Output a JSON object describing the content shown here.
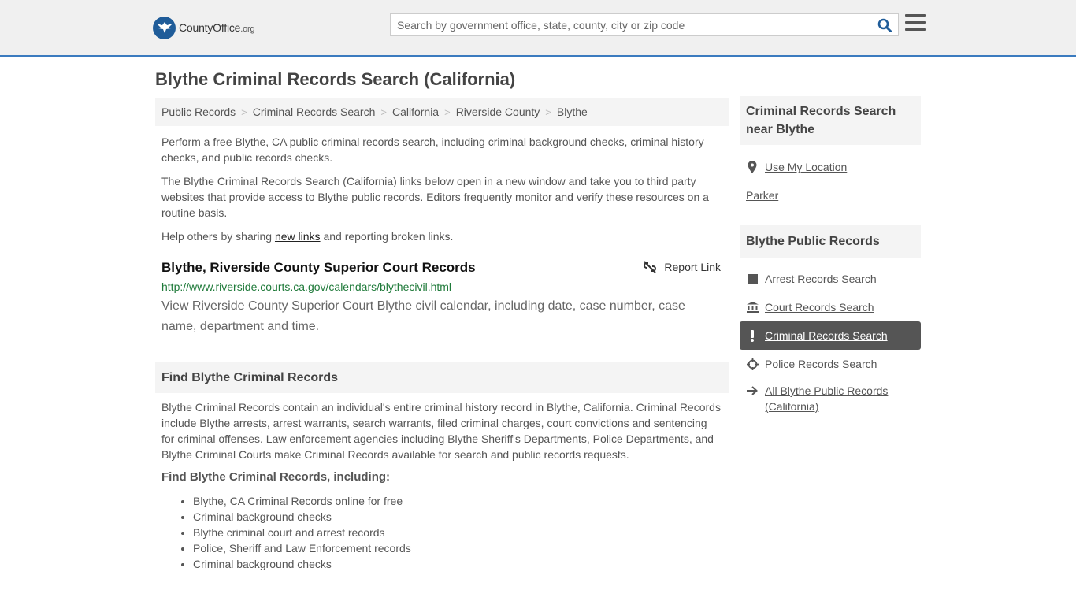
{
  "header": {
    "logo_brand": "CountyOffice",
    "logo_tld": ".org",
    "search_placeholder": "Search by government office, state, county, city or zip code"
  },
  "page_title": "Blythe Criminal Records Search (California)",
  "breadcrumb": [
    "Public Records",
    "Criminal Records Search",
    "California",
    "Riverside County",
    "Blythe"
  ],
  "intro": {
    "p1": "Perform a free Blythe, CA public criminal records search, including criminal background checks, criminal history checks, and public records checks.",
    "p2": "The Blythe Criminal Records Search (California) links below open in a new window and take you to third party websites that provide access to Blythe public records. Editors frequently monitor and verify these resources on a routine basis.",
    "p3_before": "Help others by sharing ",
    "p3_link": "new links",
    "p3_after": " and reporting broken links."
  },
  "result": {
    "title": "Blythe, Riverside County Superior Court Records",
    "report_label": "Report Link",
    "url": "http://www.riverside.courts.ca.gov/calendars/blythecivil.html",
    "description": "View Riverside County Superior Court Blythe civil calendar, including date, case number, case name, department and time."
  },
  "find": {
    "heading": "Find Blythe Criminal Records",
    "body": "Blythe Criminal Records contain an individual's entire criminal history record in Blythe, California. Criminal Records include Blythe arrests, arrest warrants, search warrants, filed criminal charges, court convictions and sentencing for criminal offenses. Law enforcement agencies including Blythe Sheriff's Departments, Police Departments, and Blythe Criminal Courts make Criminal Records available for search and public records requests.",
    "subheading": "Find Blythe Criminal Records, including:",
    "items": [
      "Blythe, CA Criminal Records online for free",
      "Criminal background checks",
      "Blythe criminal court and arrest records",
      "Police, Sheriff and Law Enforcement records",
      "Criminal background checks"
    ]
  },
  "sidebar": {
    "nearby_heading": "Criminal Records Search near Blythe",
    "use_location": "Use My Location",
    "nearby_city": "Parker",
    "public_heading": "Blythe Public Records",
    "links": [
      {
        "label": "Arrest Records Search",
        "icon": "square-icon"
      },
      {
        "label": "Court Records Search",
        "icon": "courthouse-icon"
      },
      {
        "label": "Criminal Records Search",
        "icon": "exclamation-icon"
      },
      {
        "label": "Police Records Search",
        "icon": "crosshair-icon"
      },
      {
        "label": "All Blythe Public Records (California)",
        "icon": "arrow-right-icon"
      }
    ]
  }
}
